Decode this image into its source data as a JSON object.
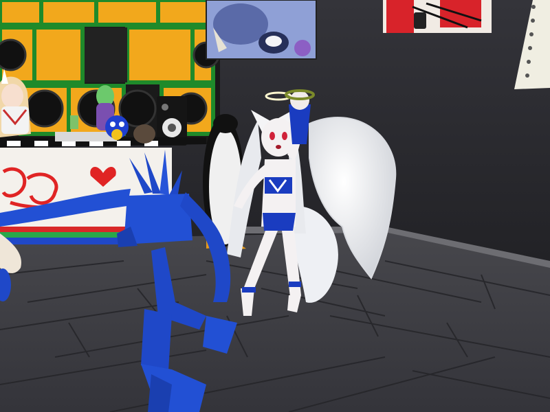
{
  "scene": {
    "colors": {
      "wall": "#2c2c30",
      "floor": "#3a3a3e",
      "floor_line": "#26262a",
      "shelf_frame": "#1f8a2a",
      "shelf_box": "#f2a81c",
      "speaker": "#1b1b1b",
      "dj_booth": "#f4f1ec",
      "heart": "#e02424",
      "blue_avatar": "#1f48c8",
      "fox_avatar_fur": "#f2f2f4",
      "fox_avatar_outfit": "#1a3cc0",
      "poster_red": "#d8232a"
    },
    "objects": [
      {
        "name": "speaker-shelf",
        "kind": "furniture"
      },
      {
        "name": "dj-booth",
        "kind": "furniture"
      },
      {
        "name": "poster-top-center",
        "kind": "wall-art"
      },
      {
        "name": "poster-top-right",
        "kind": "wall-art"
      },
      {
        "name": "notebook-poster",
        "kind": "wall-art"
      },
      {
        "name": "white-fox-angel-avatar",
        "kind": "player-avatar"
      },
      {
        "name": "blue-spiky-avatar",
        "kind": "player-avatar"
      },
      {
        "name": "penguin-avatar",
        "kind": "player-avatar"
      },
      {
        "name": "blonde-avatar",
        "kind": "player-avatar"
      },
      {
        "name": "plush-toys",
        "kind": "props"
      },
      {
        "name": "studio-monitor-speaker",
        "kind": "prop"
      }
    ]
  }
}
